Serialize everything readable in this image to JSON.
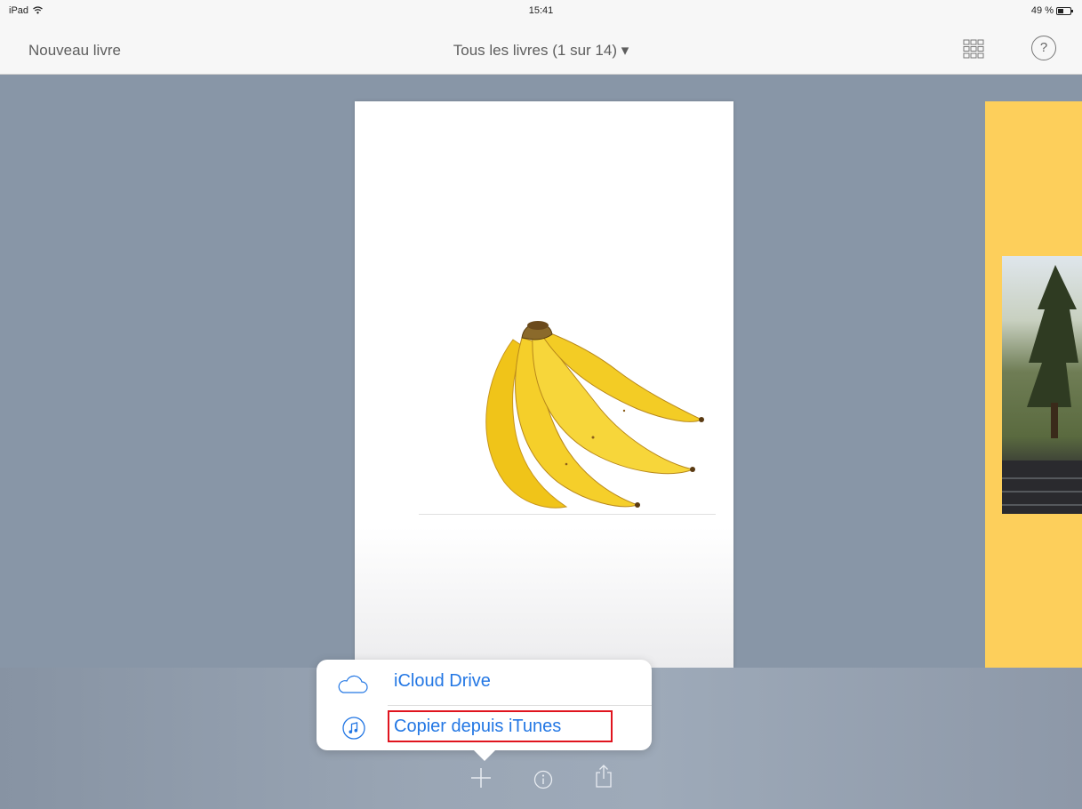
{
  "status_bar": {
    "device": "iPad",
    "time": "15:41",
    "battery": "49 %",
    "battery_level": 0.49
  },
  "nav": {
    "new_book": "Nouveau livre",
    "title": "Tous les livres (1 sur 14) ▾",
    "grid_icon": "grid-icon",
    "help_label": "?"
  },
  "popover": {
    "items": [
      {
        "label": "iCloud Drive",
        "icon": "cloud-icon"
      },
      {
        "label": "Copier depuis iTunes",
        "icon": "music-note-icon"
      }
    ],
    "highlight_color": "#e0141e"
  },
  "toolbar": {
    "icons": [
      "plus-icon",
      "info-icon",
      "share-icon"
    ]
  },
  "colors": {
    "accent": "#2377e4",
    "background": "#8896a7",
    "next_book_cover": "#fdcf5b"
  }
}
